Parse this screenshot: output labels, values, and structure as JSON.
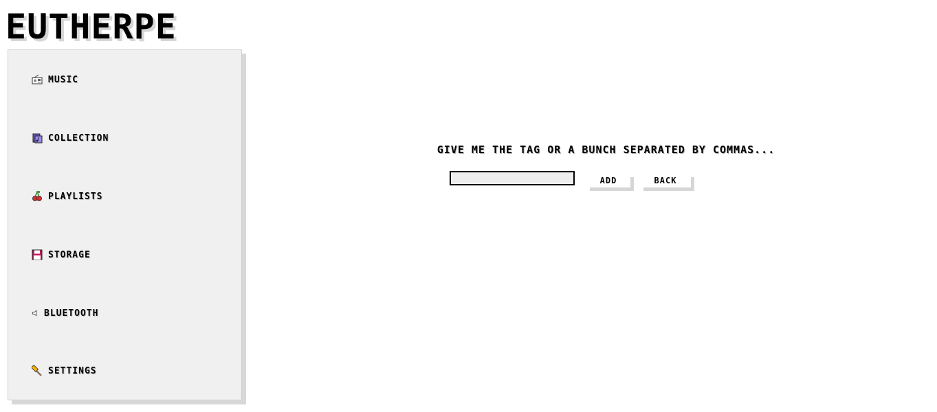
{
  "app": {
    "logo": "EUTHERPE"
  },
  "sidebar": {
    "items": [
      {
        "label": "MUSIC",
        "icon": "radio-icon"
      },
      {
        "label": "COLLECTION",
        "icon": "music-notes-icon"
      },
      {
        "label": "PLAYLISTS",
        "icon": "cherries-icon"
      },
      {
        "label": "STORAGE",
        "icon": "floppy-disk-icon"
      },
      {
        "label": "BLUETOOTH",
        "icon": "speaker-icon"
      },
      {
        "label": "SETTINGS",
        "icon": "hammer-icon"
      }
    ]
  },
  "main": {
    "prompt": "GIVE ME THE TAG OR A BUNCH SEPARATED BY COMMAS...",
    "tag_input": {
      "value": "",
      "placeholder": ""
    },
    "add_label": "ADD",
    "back_label": "BACK"
  },
  "colors": {
    "background": "#ffffff",
    "sidebar_bg": "#f0f0f0",
    "shadow": "#d6d6d6",
    "text": "#000000"
  }
}
